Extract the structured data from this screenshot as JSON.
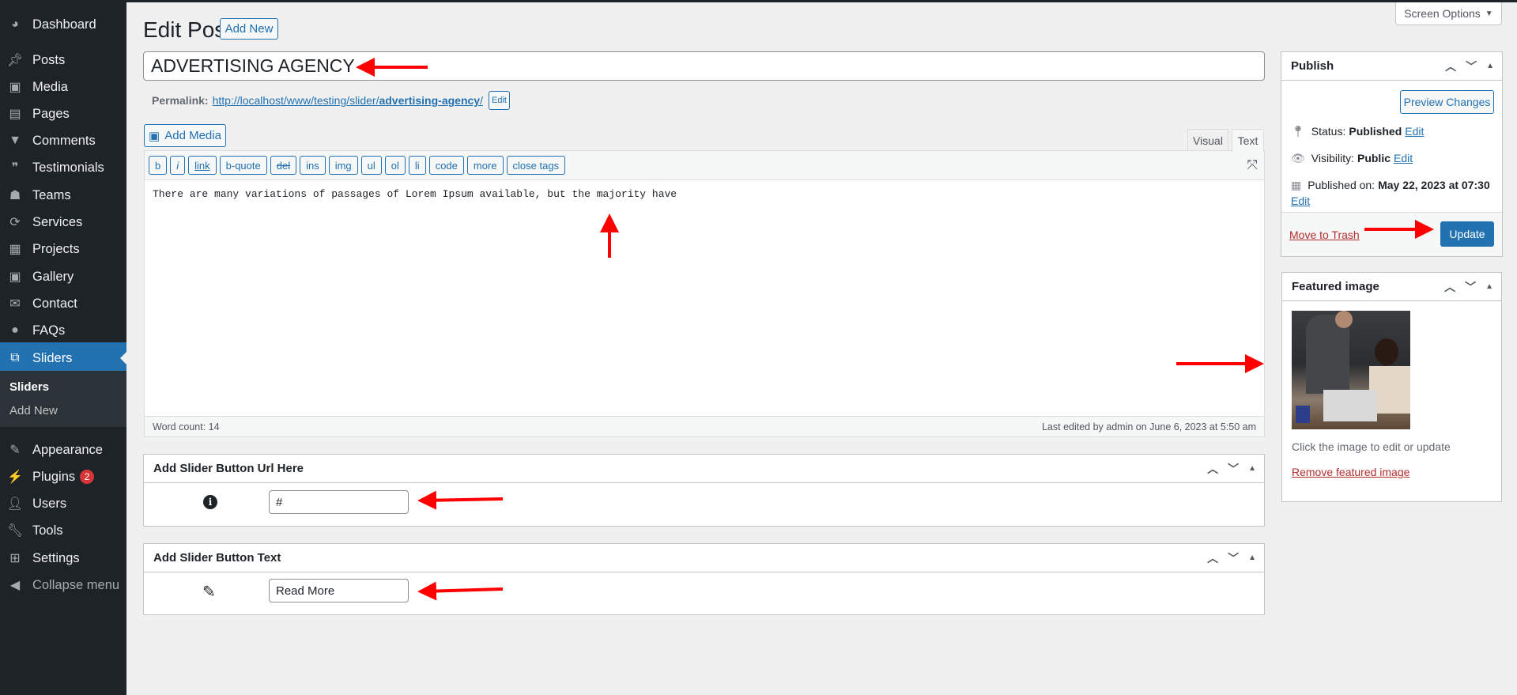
{
  "sidebar": {
    "items": [
      {
        "label": "Dashboard",
        "icon": "dashboard-icon"
      },
      {
        "label": "Posts",
        "icon": "pin-icon"
      },
      {
        "label": "Media",
        "icon": "media-icon"
      },
      {
        "label": "Pages",
        "icon": "pages-icon"
      },
      {
        "label": "Comments",
        "icon": "comment-icon"
      },
      {
        "label": "Testimonials",
        "icon": "testimonials-icon"
      },
      {
        "label": "Teams",
        "icon": "groups-icon"
      },
      {
        "label": "Services",
        "icon": "update-icon"
      },
      {
        "label": "Projects",
        "icon": "layout-icon"
      },
      {
        "label": "Gallery",
        "icon": "gallery-icon"
      },
      {
        "label": "Contact",
        "icon": "email-icon"
      },
      {
        "label": "FAQs",
        "icon": "chat-icon"
      },
      {
        "label": "Sliders",
        "icon": "slides-icon",
        "active": true
      }
    ],
    "submenu": [
      "Sliders",
      "Add New"
    ],
    "items2": [
      {
        "label": "Appearance",
        "icon": "brush-icon"
      },
      {
        "label": "Plugins",
        "icon": "plugin-icon",
        "badge": "2"
      },
      {
        "label": "Users",
        "icon": "users-icon"
      },
      {
        "label": "Tools",
        "icon": "wrench-icon"
      },
      {
        "label": "Settings",
        "icon": "settings-icon"
      }
    ],
    "collapse": "Collapse menu"
  },
  "header": {
    "title": "Edit Post",
    "add_new": "Add New",
    "screen_options": "Screen Options"
  },
  "post": {
    "title": "ADVERTISING AGENCY",
    "permalink_label": "Permalink:",
    "permalink_base": "http://localhost/www/testing/slider/",
    "permalink_slug": "advertising-agency",
    "permalink_end": "/",
    "edit": "Edit"
  },
  "editor": {
    "add_media": "Add Media",
    "tabs": [
      "Visual",
      "Text"
    ],
    "active_tab": "Text",
    "quicktags": [
      "b",
      "i",
      "link",
      "b-quote",
      "del",
      "ins",
      "img",
      "ul",
      "ol",
      "li",
      "code",
      "more",
      "close tags"
    ],
    "content": "There are many variations of passages of Lorem Ipsum available, but the majority have",
    "word_count": "Word count: 14",
    "last_edited": "Last edited by admin on June 6, 2023 at 5:50 am"
  },
  "metaboxes": [
    {
      "title": "Add Slider Button Url Here",
      "value": "#",
      "icon": "info-icon"
    },
    {
      "title": "Add Slider Button Text",
      "value": "Read More",
      "icon": "pencil-icon"
    }
  ],
  "publish": {
    "title": "Publish",
    "preview": "Preview Changes",
    "status_label": "Status:",
    "status": "Published",
    "visibility_label": "Visibility:",
    "visibility": "Public",
    "published_label": "Published on:",
    "published": "May 22, 2023 at 07:30",
    "edit": "Edit",
    "trash": "Move to Trash",
    "update": "Update"
  },
  "featured": {
    "title": "Featured image",
    "hint": "Click the image to edit or update",
    "remove": "Remove featured image"
  },
  "colors": {
    "accent": "#2271b1",
    "sidebar": "#1d2327",
    "annotation": "#ff0000",
    "danger": "#b32d2e"
  }
}
